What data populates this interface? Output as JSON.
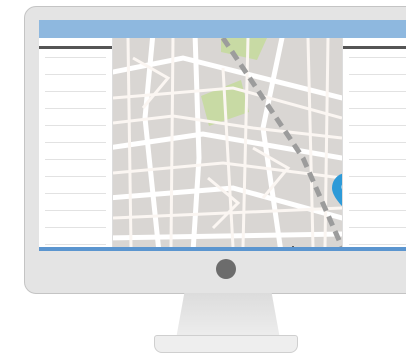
{
  "colors": {
    "topbar": "#8eb8df",
    "bottombar": "#5b95cf",
    "map_background": "#d9d6d3",
    "map_roads": "#ffffff",
    "map_park": "#c8daa4",
    "map_rail": "#9c9c9c",
    "pin": "#2d9ad8",
    "monitor_body": "#e4e4e4",
    "power_button": "#6c6c6c"
  },
  "icons": {
    "pin": "map-pin-icon",
    "scale": "scale-bar-icon",
    "power": "power-button-icon"
  },
  "left_panel": {
    "row_count": 12
  },
  "right_panel": {
    "row_count": 12
  }
}
